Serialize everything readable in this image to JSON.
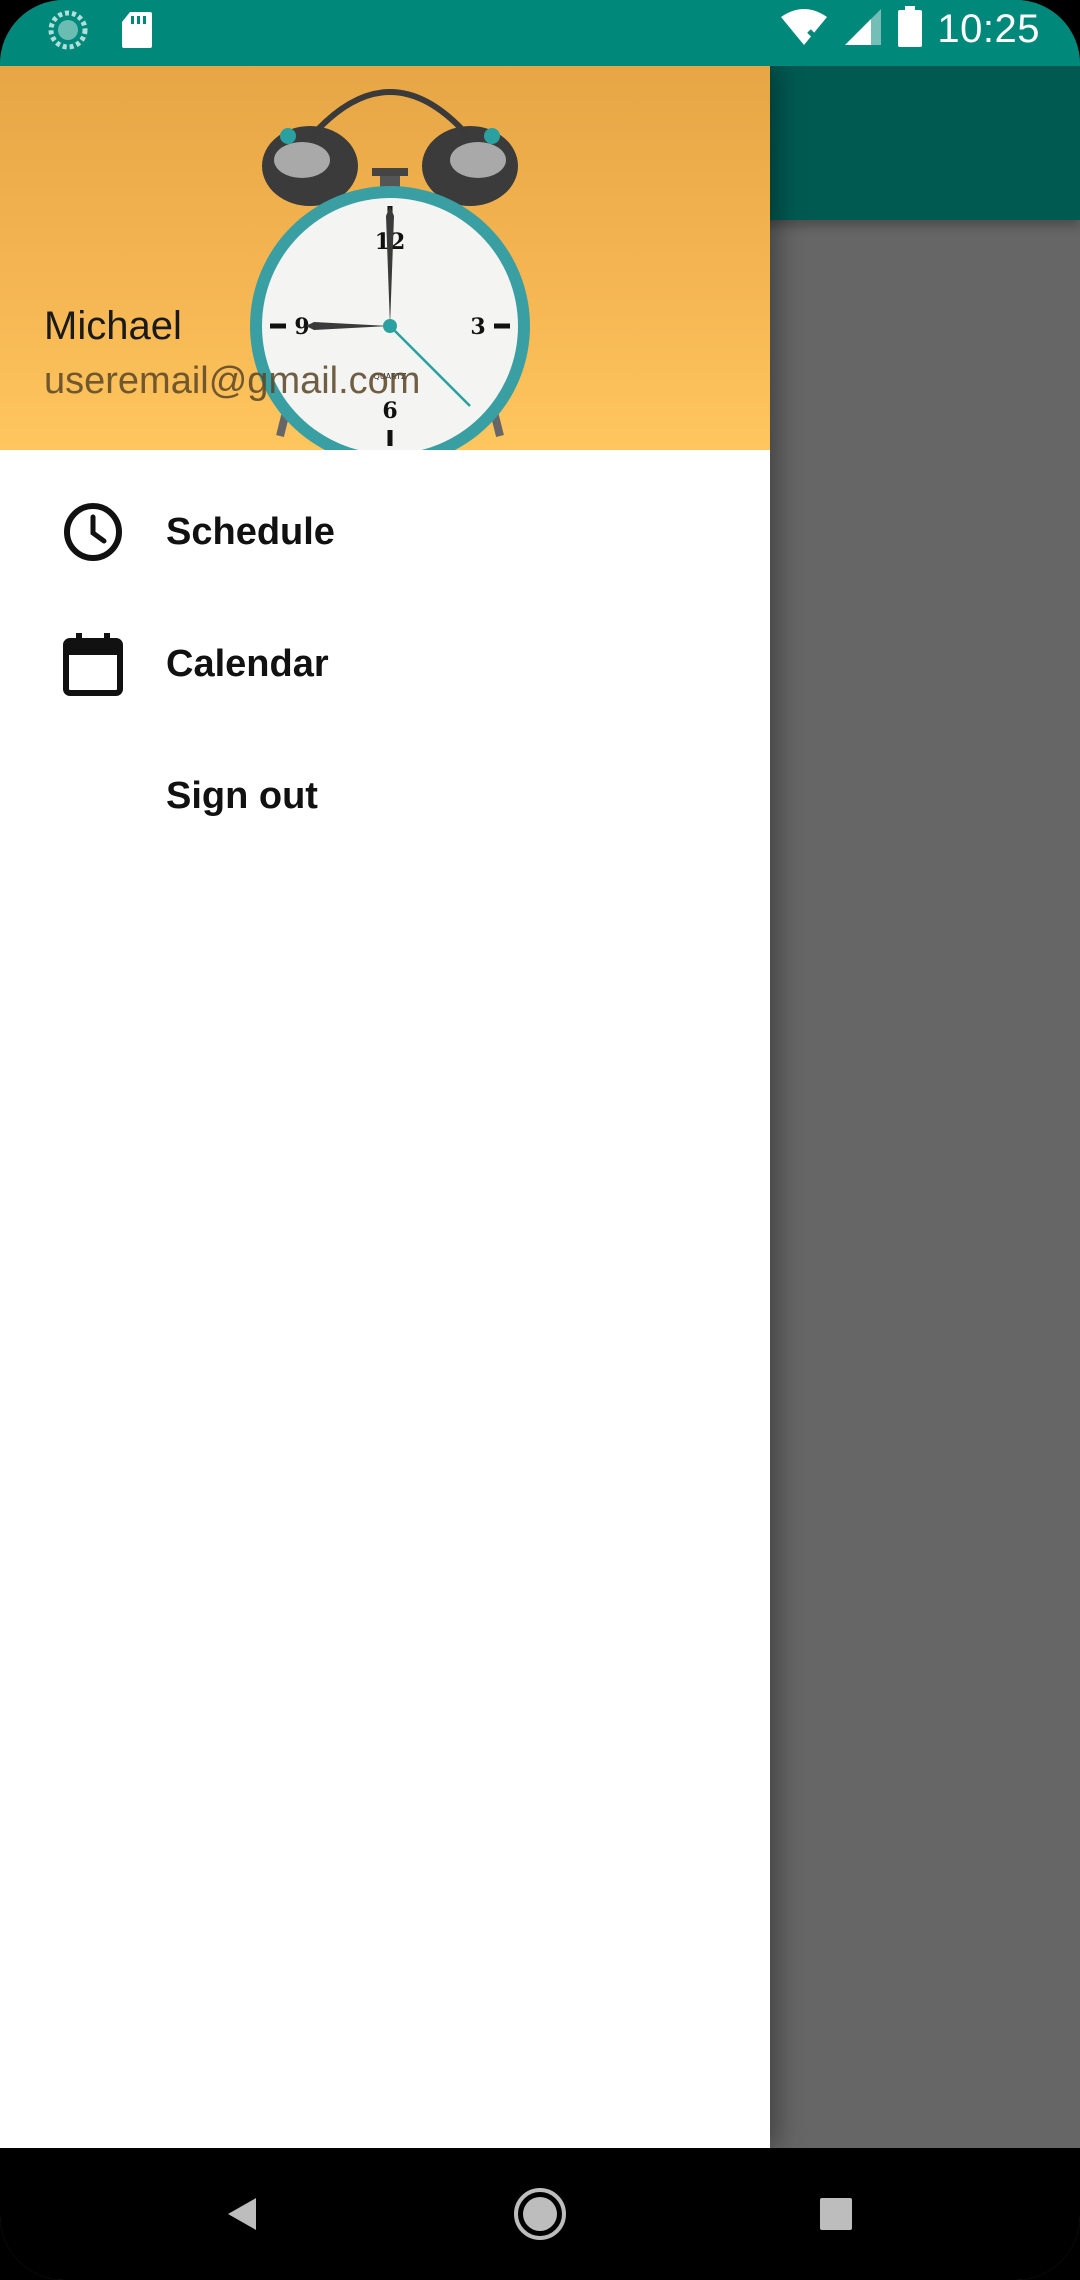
{
  "status_bar": {
    "time": "10:25",
    "icons": [
      "data-saver-icon",
      "sd-card-icon",
      "wifi-off-icon",
      "cell-signal-icon",
      "battery-icon"
    ]
  },
  "drawer": {
    "header": {
      "user_name": "Michael",
      "user_email": "useremail@gmail.com"
    },
    "items": [
      {
        "label": "Schedule",
        "icon": "clock-icon"
      },
      {
        "label": "Calendar",
        "icon": "calendar-icon"
      },
      {
        "label": "Sign out",
        "icon": ""
      }
    ]
  },
  "nav_bar": {
    "buttons": [
      "back-icon",
      "home-icon",
      "recents-icon"
    ]
  },
  "colors": {
    "status_bar": "#00897B",
    "toolbar": "#005a52",
    "scrim": "#666666",
    "drawer_bg": "#ffffff",
    "header_gradient_top": "#e7a645",
    "header_gradient_bottom": "#ffc65e"
  }
}
